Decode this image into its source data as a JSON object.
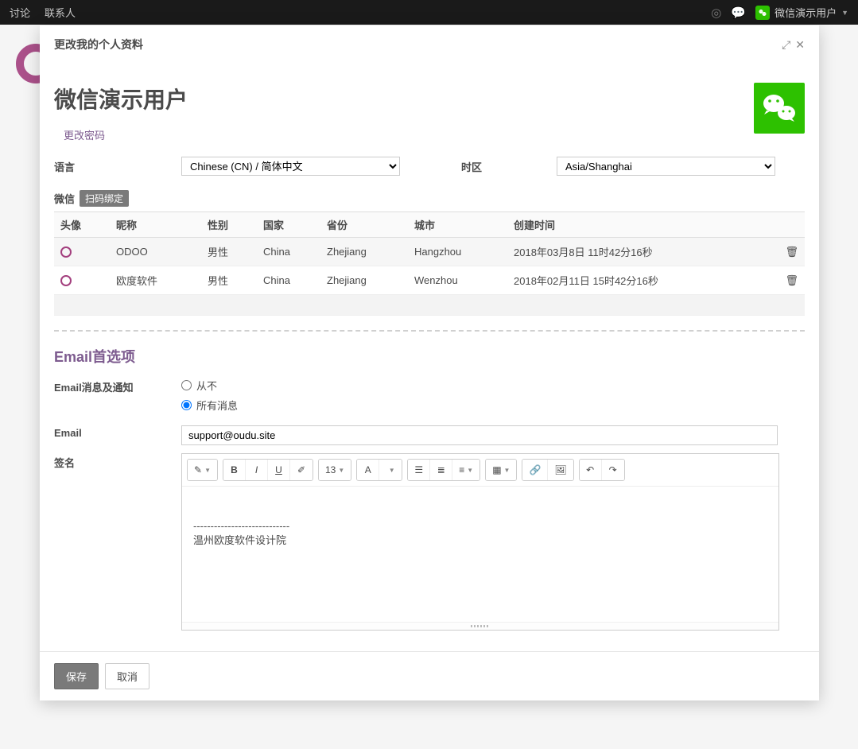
{
  "nav": {
    "discuss": "讨论",
    "contacts": "联系人",
    "user_display": "微信演示用户"
  },
  "modal": {
    "title": "更改我的个人资料",
    "profile_name": "微信演示用户",
    "change_password": "更改密码",
    "lang_label": "语言",
    "lang_value": "Chinese (CN) / 简体中文",
    "tz_label": "时区",
    "tz_value": "Asia/Shanghai"
  },
  "wechat": {
    "label": "微信",
    "scan_bind": "扫码绑定",
    "columns": {
      "avatar": "头像",
      "nickname": "昵称",
      "gender": "性别",
      "country": "国家",
      "province": "省份",
      "city": "城市",
      "created": "创建时间"
    },
    "rows": [
      {
        "nickname": "ODOO",
        "gender": "男性",
        "country": "China",
        "province": "Zhejiang",
        "city": "Hangzhou",
        "created": "2018年03月8日 11时42分16秒"
      },
      {
        "nickname": "欧度软件",
        "gender": "男性",
        "country": "China",
        "province": "Zhejiang",
        "city": "Wenzhou",
        "created": "2018年02月11日 15时42分16秒"
      }
    ]
  },
  "email_prefs": {
    "section_title": "Email首选项",
    "notify_label": "Email消息及通知",
    "radio_never": "从不",
    "radio_all": "所有消息",
    "email_label": "Email",
    "email_value": "support@oudu.site",
    "signature_label": "签名",
    "font_size": "13",
    "sig_separator": "----------------------------",
    "sig_text": "温州欧度软件设计院"
  },
  "footer": {
    "save": "保存",
    "cancel": "取消"
  },
  "icons": {
    "font_color_letter": "A"
  }
}
